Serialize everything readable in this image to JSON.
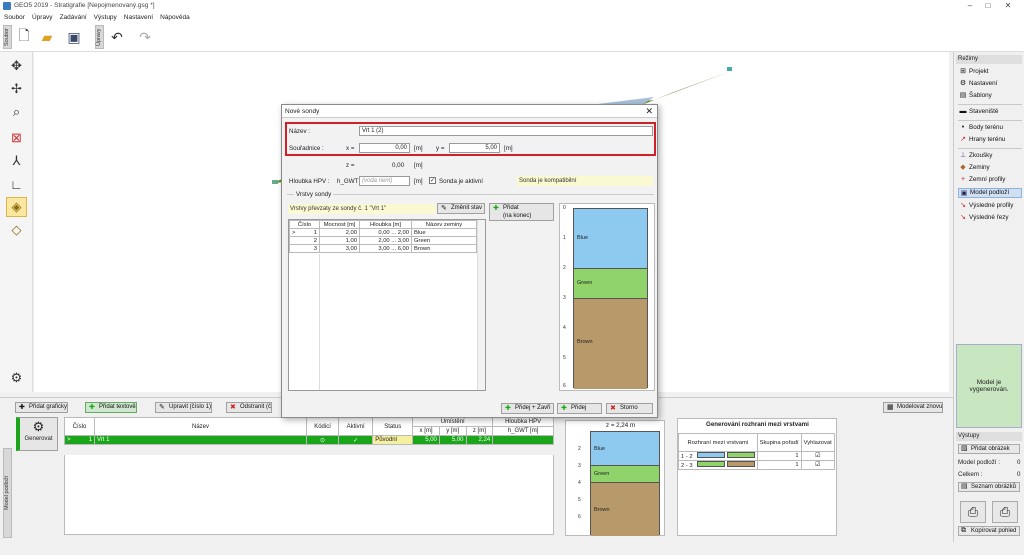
{
  "app": {
    "title": "GEO5 2019 - Stratigrafie [Nepojmenovaný.gsg *]"
  },
  "window_controls": {
    "minimize": "–",
    "maximize": "□",
    "close": "✕"
  },
  "menu": [
    "Soubor",
    "Úpravy",
    "Zadávání",
    "Výstupy",
    "Nastavení",
    "Nápověda"
  ],
  "toolbar": {
    "file_group": "Soubor",
    "edit_group": "Úpravy"
  },
  "right_panel": {
    "modes_header": "Režimy",
    "items": [
      {
        "label": "Projekt",
        "icon": "⊞"
      },
      {
        "label": "Nastavení",
        "icon": "⚙"
      },
      {
        "label": "Šablony",
        "icon": "▤"
      },
      {
        "label": "Staveniště",
        "icon": "▬"
      },
      {
        "label": "Body terénu",
        "icon": "•"
      },
      {
        "label": "Hrany terénu",
        "icon": "↗"
      },
      {
        "label": "Zkoušky",
        "icon": "⊥"
      },
      {
        "label": "Zeminy",
        "icon": "◆"
      },
      {
        "label": "Zemní profily",
        "icon": "+"
      },
      {
        "label": "Model podloží",
        "icon": "▣"
      },
      {
        "label": "Výsledné profily",
        "icon": "↘"
      },
      {
        "label": "Výsledné řezy",
        "icon": "↘"
      }
    ],
    "status": "Model je vygenerován.",
    "outputs_header": "Výstupy",
    "add_image": "Přidat obrázek",
    "model_label": "Model podloží :",
    "model_value": "0",
    "total_label": "Celkem :",
    "total_value": "0",
    "image_list": "Seznam obrázků",
    "copy_view": "Kopírovat pohled"
  },
  "bottom": {
    "side_label": "Model podloží",
    "add_graphic": "Přidat graficky",
    "add_text": "Přidat textově",
    "edit": "Upravit (číslo 1)",
    "remove": "Odstranit (č",
    "generate": "Generovat",
    "model_again": "Modelovat znovu",
    "table_headers": [
      "Číslo",
      "Název",
      "Kódicí",
      "Aktivní",
      "Status",
      "x [m]",
      "y [m]",
      "z [m]",
      "h_GWT [m]"
    ],
    "location_header": "Umístění",
    "hpv_header": "Hloubka HPV",
    "rows": [
      {
        "marker": ">",
        "num": "1",
        "name": "Vrt 1",
        "code": "⊙",
        "active": "✓",
        "status": "Původní",
        "x": "5,00",
        "y": "5,00",
        "z": "2,24",
        "h": ""
      }
    ],
    "profile_label": "z = 2,24 m",
    "interfaces_title": "Generování rozhraní mezi vrstvami",
    "interfaces_headers": [
      "Rozhraní mezi vrstvami",
      "Skupina pořadí",
      "Vyhlazovat"
    ],
    "interfaces": [
      {
        "name": "1 - 2",
        "group": "1",
        "smooth": "☑"
      },
      {
        "name": "2 - 3",
        "group": "1",
        "smooth": "☑"
      }
    ]
  },
  "dialog": {
    "title": "Nové sondy",
    "name_label": "Název :",
    "name_value": "Vrt 1 (2)",
    "coords_label": "Souřadnice :",
    "x_label": "x =",
    "x_value": "0,00",
    "x_unit": "[m]",
    "y_label": "y =",
    "y_value": "5,00",
    "y_unit": "[m]",
    "z_label": "z =",
    "z_value": "0,00",
    "z_unit": "[m]",
    "hpv_label": "Hloubka HPV :",
    "hpv_sub": "h_GWT =",
    "hpv_placeholder": "(voda není)",
    "hpv_unit": "[m]",
    "active_label": "Sonda je aktivní",
    "active_check": "✓",
    "compat_hint": "Sonda je kompatibilní",
    "layers_group": "Vrstvy sondy",
    "layers_hint": "Vrstvy převzaty ze sondy č. 1 \"Vrt 1\"",
    "change_state": "Změnit stav",
    "add_end": "Přidat\n(na konec)",
    "layers_headers": [
      "Číslo",
      "Mocnost [m]",
      "Hloubka [m]",
      "Název zeminy"
    ],
    "layers": [
      {
        "marker": ">",
        "num": "1",
        "thickness": "2,00",
        "depth": "0,00 ... 2,00",
        "soil": "Blue"
      },
      {
        "marker": "",
        "num": "2",
        "thickness": "1,00",
        "depth": "2,00 ... 3,00",
        "soil": "Green"
      },
      {
        "marker": "",
        "num": "3",
        "thickness": "3,00",
        "depth": "3,00 ... 6,00",
        "soil": "Brown"
      }
    ],
    "profile_ticks": [
      "0",
      "1",
      "2",
      "3",
      "4",
      "5",
      "6"
    ],
    "add_close": "Přidej + Zavři",
    "add": "Přidej",
    "cancel": "Storno"
  },
  "colors": {
    "blue": "#8ec9ef",
    "green": "#8fd36a",
    "brown": "#b89a6a",
    "accent_green": "#1aa51a",
    "highlight_red": "#d0202a"
  }
}
